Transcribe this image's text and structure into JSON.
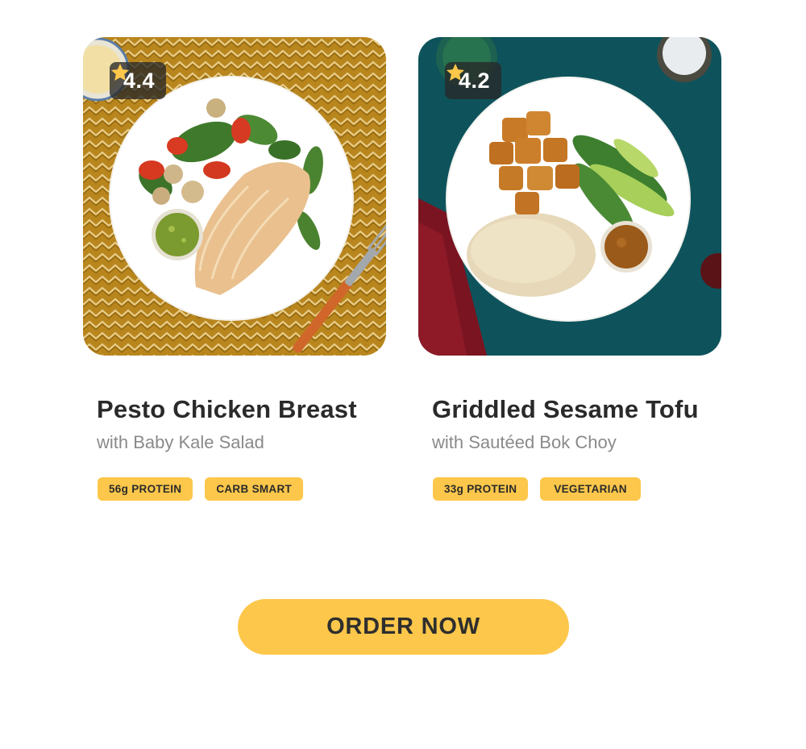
{
  "cards": [
    {
      "rating": "4.4",
      "title": "Pesto Chicken Breast",
      "subtitle": "with Baby Kale Salad",
      "tags": [
        "56g PROTEIN",
        "CARB SMART"
      ],
      "photo_background": "#b9861e"
    },
    {
      "rating": "4.2",
      "title": "Griddled Sesame Tofu",
      "subtitle": "with Sautéed Bok Choy",
      "tags": [
        "33g PROTEIN",
        "VEGETARIAN"
      ],
      "photo_background": "#0f5a63"
    }
  ],
  "cta": {
    "label": "ORDER NOW"
  },
  "colors": {
    "accent": "#fcc74a",
    "title": "#2a2a2a",
    "subtitle": "#8a8a8a",
    "badge": "#282828"
  }
}
